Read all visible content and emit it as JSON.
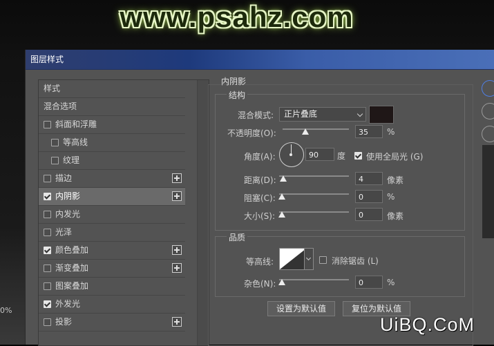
{
  "watermark": "www.psahz.com",
  "background": {
    "percent_text": "0%"
  },
  "dialog": {
    "title": "图层样式"
  },
  "style_list": {
    "items": [
      {
        "label": "样式",
        "has_checkbox": false,
        "checked": false,
        "has_plus": false,
        "active": false,
        "indent": false
      },
      {
        "label": "混合选项",
        "has_checkbox": false,
        "checked": false,
        "has_plus": false,
        "active": false,
        "indent": false
      },
      {
        "label": "斜面和浮雕",
        "has_checkbox": true,
        "checked": false,
        "has_plus": false,
        "active": false,
        "indent": false
      },
      {
        "label": "等高线",
        "has_checkbox": true,
        "checked": false,
        "has_plus": false,
        "active": false,
        "indent": true
      },
      {
        "label": "纹理",
        "has_checkbox": true,
        "checked": false,
        "has_plus": false,
        "active": false,
        "indent": true
      },
      {
        "label": "描边",
        "has_checkbox": true,
        "checked": false,
        "has_plus": true,
        "active": false,
        "indent": false
      },
      {
        "label": "内阴影",
        "has_checkbox": true,
        "checked": true,
        "has_plus": true,
        "active": true,
        "indent": false
      },
      {
        "label": "内发光",
        "has_checkbox": true,
        "checked": false,
        "has_plus": false,
        "active": false,
        "indent": false
      },
      {
        "label": "光泽",
        "has_checkbox": true,
        "checked": false,
        "has_plus": false,
        "active": false,
        "indent": false
      },
      {
        "label": "颜色叠加",
        "has_checkbox": true,
        "checked": true,
        "has_plus": true,
        "active": false,
        "indent": false
      },
      {
        "label": "渐变叠加",
        "has_checkbox": true,
        "checked": false,
        "has_plus": true,
        "active": false,
        "indent": false
      },
      {
        "label": "图案叠加",
        "has_checkbox": true,
        "checked": false,
        "has_plus": false,
        "active": false,
        "indent": false
      },
      {
        "label": "外发光",
        "has_checkbox": true,
        "checked": true,
        "has_plus": false,
        "active": false,
        "indent": false
      },
      {
        "label": "投影",
        "has_checkbox": true,
        "checked": false,
        "has_plus": true,
        "active": false,
        "indent": false
      }
    ]
  },
  "panel": {
    "title": "内阴影",
    "structure": {
      "title": "结构",
      "blend_mode_label": "混合模式:",
      "blend_mode_value": "正片叠底",
      "shadow_color": "#1f1717",
      "opacity_label": "不透明度(O):",
      "opacity_value": "35",
      "opacity_unit": "%",
      "angle_label": "角度(A):",
      "angle_value": "90",
      "angle_unit": "度",
      "global_light_label": "使用全局光 (G)",
      "global_light_checked": true,
      "distance_label": "距离(D):",
      "distance_value": "4",
      "distance_unit": "像素",
      "choke_label": "阻塞(C):",
      "choke_value": "0",
      "choke_unit": "%",
      "size_label": "大小(S):",
      "size_value": "0",
      "size_unit": "像素"
    },
    "quality": {
      "title": "品质",
      "contour_label": "等高线:",
      "antialias_label": "消除锯齿 (L)",
      "antialias_checked": false,
      "noise_label": "杂色(N):",
      "noise_value": "0",
      "noise_unit": "%"
    },
    "buttons": {
      "make_default": "设置为默认值",
      "reset_default": "复位为默认值"
    }
  },
  "corner_watermark": "UiBQ.CoM"
}
